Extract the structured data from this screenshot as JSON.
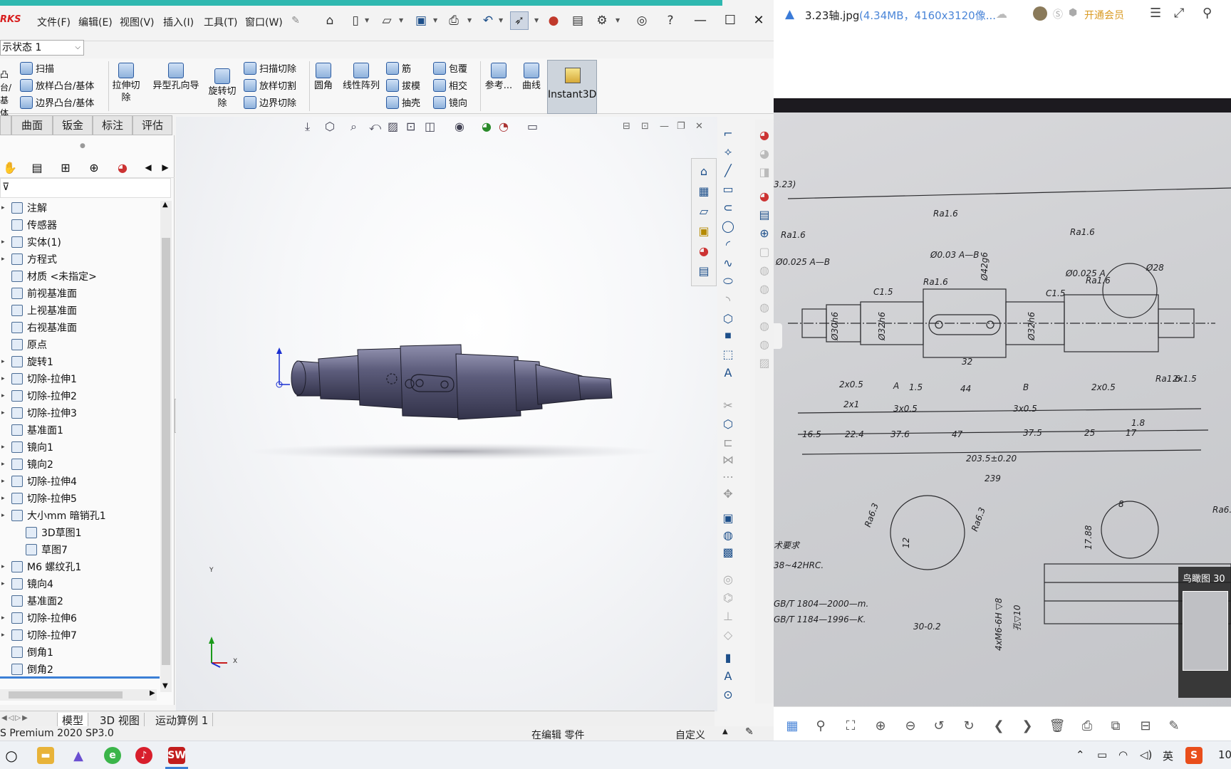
{
  "sw": {
    "logo": "RKS",
    "menu": [
      "文件(F)",
      "编辑(E)",
      "视图(V)",
      "插入(I)",
      "工具(T)",
      "窗口(W)"
    ],
    "config_state": "示状态 1",
    "cmd": {
      "boss_partial": "凸台/基体",
      "sweep": "扫描",
      "loft": "放样凸台/基体",
      "boundary": "边界凸台/基体",
      "extrude_cut": "拉伸切除",
      "hole_wizard": "异型孔向导",
      "revolve_cut": "旋转切除",
      "swept_cut": "扫描切除",
      "lofted_cut": "放样切割",
      "boundary_cut": "边界切除",
      "fillet": "圆角",
      "linear_pattern": "线性阵列",
      "rib": "筋",
      "draft": "拔模",
      "shell": "抽壳",
      "wrap": "包覆",
      "intersect": "相交",
      "mirror": "镜向",
      "reference": "参考...",
      "curves": "曲线",
      "instant3d": "Instant3D"
    },
    "tabs": [
      "曲面",
      "钣金",
      "标注",
      "评估"
    ],
    "tree": [
      {
        "label": "注解",
        "expand": true
      },
      {
        "label": "传感器",
        "expand": false
      },
      {
        "label": "实体(1)",
        "expand": true
      },
      {
        "label": "方程式",
        "expand": true
      },
      {
        "label": "材质 <未指定>",
        "expand": false
      },
      {
        "label": "前视基准面",
        "expand": false
      },
      {
        "label": "上视基准面",
        "expand": false
      },
      {
        "label": "右视基准面",
        "expand": false
      },
      {
        "label": "原点",
        "expand": false
      },
      {
        "label": "旋转1",
        "expand": true
      },
      {
        "label": "切除-拉伸1",
        "expand": true
      },
      {
        "label": "切除-拉伸2",
        "expand": true
      },
      {
        "label": "切除-拉伸3",
        "expand": true
      },
      {
        "label": "基准面1",
        "expand": false
      },
      {
        "label": "镜向1",
        "expand": true
      },
      {
        "label": "镜向2",
        "expand": true
      },
      {
        "label": "切除-拉伸4",
        "expand": true
      },
      {
        "label": "切除-拉伸5",
        "expand": true
      },
      {
        "label": "大小mm 暗销孔1",
        "expand": true
      },
      {
        "label": "3D草图1",
        "expand": false
      },
      {
        "label": "草图7",
        "expand": false
      },
      {
        "label": "M6 螺纹孔1",
        "expand": true
      },
      {
        "label": "镜向4",
        "expand": true
      },
      {
        "label": "基准面2",
        "expand": false
      },
      {
        "label": "切除-拉伸6",
        "expand": true
      },
      {
        "label": "切除-拉伸7",
        "expand": true
      },
      {
        "label": "倒角1",
        "expand": false
      },
      {
        "label": "倒角2",
        "expand": false
      }
    ],
    "bottom_tabs": [
      "模型",
      "3D 视图",
      "运动算例 1"
    ],
    "status": {
      "product": "S Premium 2020 SP3.0",
      "editing": "在编辑 零件",
      "custom": "自定义"
    },
    "triad": {
      "x": "X",
      "y": "Y"
    }
  },
  "viewer": {
    "filename": "3.23轴.jpg",
    "meta": "(4.34MB，4160x3120像...",
    "vip": "开通会员",
    "birdseye": "鸟瞰图 30",
    "drawing": {
      "header": "3.23)",
      "ra16": "Ra1.6",
      "ra63": "Ra6.3",
      "tol1": "Ø0.025 A—B",
      "tol2": "Ø0.03 A—B",
      "tol3": "Ø0.025 A",
      "d42": "Ø42g6",
      "d30": "Ø30h6",
      "d32a": "Ø32h6",
      "d32b": "Ø32h6",
      "d28": "Ø28",
      "c15a": "C1.5",
      "c15b": "C1.5",
      "dim_2x05a": "2x0.5",
      "dim_2x1": "2x1",
      "dim_3x05a": "3x0.5",
      "dim_15": "1.5",
      "dim_44": "44",
      "dim_32": "32",
      "dim_3x05b": "3x0.5",
      "dim_2x05b": "2x0.5",
      "dim_2x15": "2x1.5",
      "dim_18": "1.8",
      "dim_165": "16.5",
      "dim_224": "22.4",
      "dim_376": "37.6",
      "dim_47": "47",
      "dim_375": "37.5",
      "dim_25": "25",
      "dim_17": "17",
      "dim_2035": "203.5±0.20",
      "dim_239": "239",
      "datum_a": "A",
      "datum_b": "B",
      "req_title": "术要求",
      "req_hrc": "38~42HRC.",
      "req_gb1": "GB/T 1804—2000—m.",
      "req_gb2": "GB/T 1184—1996—K.",
      "dim_30_02": "30-0.2",
      "dim_12": "12",
      "dim_m6": "4xM6-6H ▽8",
      "dim_hole": "孔▽10",
      "dim_8": "8",
      "dim_1788": "17.88"
    }
  },
  "taskbar": {
    "input_method": "英",
    "time": "10"
  },
  "colors": {
    "sw_accent": "#1d4f8a",
    "viewer_accent": "#4b86d8",
    "vip": "#d99a22",
    "paper": "#cfd0d3"
  }
}
